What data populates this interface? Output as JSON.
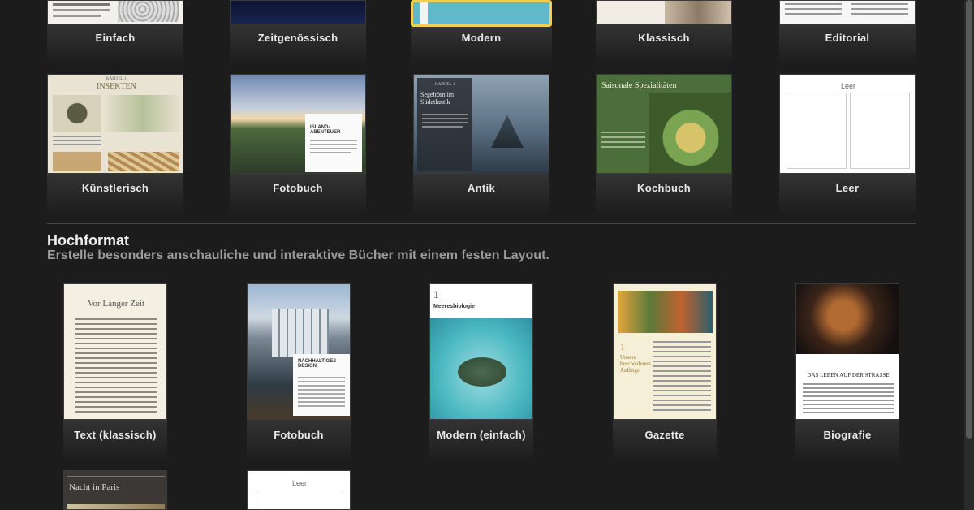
{
  "landscape": {
    "row1": [
      "Einfach",
      "Zeitgenössisch",
      "Modern",
      "Klassisch",
      "Editorial"
    ],
    "row2": [
      "Künstlerisch",
      "Fotobuch",
      "Antik",
      "Kochbuch",
      "Leer"
    ],
    "selected": "Modern"
  },
  "thumb_text": {
    "kapitel1": "KAPITEL 1",
    "insekten": "INSEKTEN",
    "island": "ISLAND-ABENTEUER",
    "antik_kapitel": "KAPITEL 1",
    "antik_title": "Segeltörn im Südatlantik",
    "kochbuch_title": "Saisonale Spezialitäten",
    "leer": "Leer"
  },
  "portrait": {
    "title": "Hochformat",
    "subtitle": "Erstelle besonders anschauliche und interaktive Bücher mit einem festen Layout.",
    "items": [
      "Text (klassisch)",
      "Fotobuch",
      "Modern (einfach)",
      "Gazette",
      "Biografie"
    ],
    "row2_text": {
      "nacht": "Nacht in Paris",
      "leer": "Leer"
    },
    "thumb_text": {
      "vor_langer_zeit": "Vor Langer Zeit",
      "nachhaltiges": "NACHHALTIGES DESIGN",
      "meeresbiologie": "Meeresbiologie",
      "meer_num": "1",
      "unsere": "Unsere bescheidenen Anfänge",
      "gaz_num": "1",
      "leben": "DAS LEBEN AUF DER STRASSE"
    }
  }
}
